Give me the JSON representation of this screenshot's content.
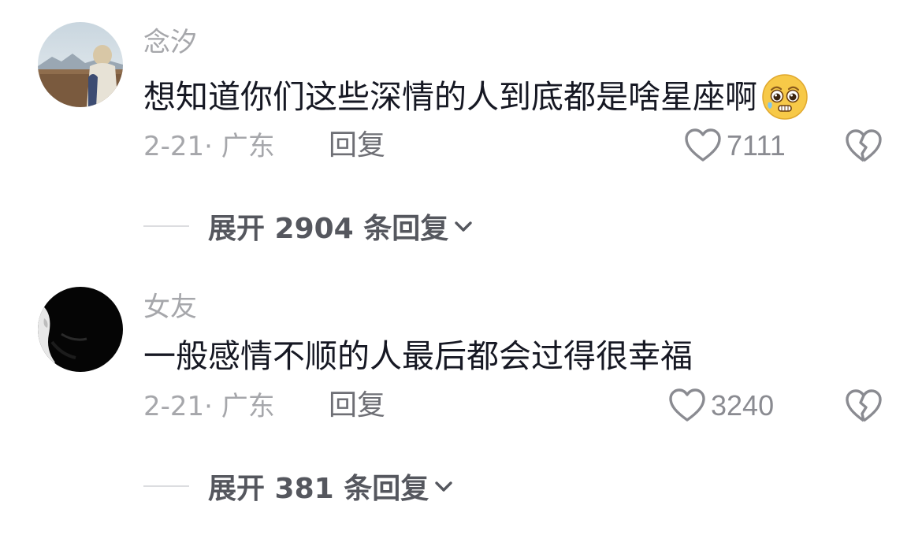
{
  "comments": [
    {
      "username": "念汐",
      "text": "想知道你们这些深情的人到底都是啥星座啊",
      "emoji": "pleading-face-emoji",
      "date_location": "2-21· 广东",
      "reply_label": "回复",
      "likes": "7111",
      "expand_label": "展开 2904 条回复"
    },
    {
      "username": "女友",
      "text": "一般感情不顺的人最后都会过得很幸福",
      "date_location": "2-21· 广东",
      "reply_label": "回复",
      "likes": "3240",
      "expand_label": "展开 381 条回复"
    }
  ],
  "icons": {
    "like": "heart-outline-icon",
    "dislike": "broken-heart-icon",
    "expand": "chevron-down-icon"
  },
  "colors": {
    "text_primary": "#161823",
    "text_secondary": "#a6a7ab",
    "reply": "#6e6f75",
    "expand": "#55575e",
    "icon": "#8a8b91"
  }
}
